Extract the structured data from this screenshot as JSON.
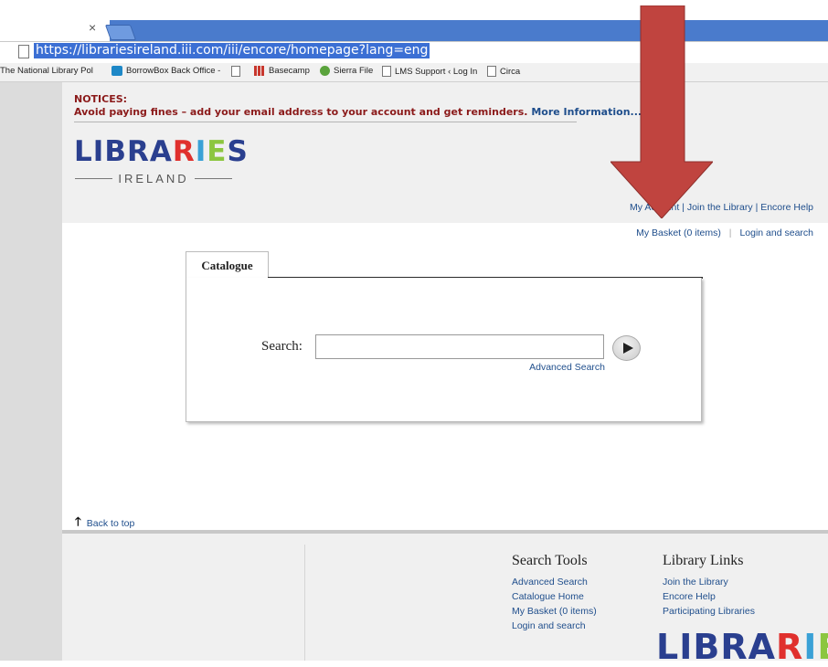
{
  "browser": {
    "tab_close": "×",
    "url": "https://librariesireland.iii.com/iii/encore/homepage?lang=eng",
    "bookmarks": [
      {
        "label": "The National Library Pol",
        "icon": "none"
      },
      {
        "label": "BorrowBox Back Office -",
        "icon": "borrowbox-icon"
      },
      {
        "label": "",
        "icon": "page-icon"
      },
      {
        "label": "Basecamp",
        "icon": "basecamp-icon"
      },
      {
        "label": "Sierra File",
        "icon": "sierra-icon"
      },
      {
        "label": "LMS Support ‹ Log In",
        "icon": "page-icon"
      },
      {
        "label": "Circa",
        "icon": "page-icon"
      }
    ]
  },
  "notice": {
    "title": "NOTICES:",
    "text": "Avoid paying fines – add your email address to your account and get reminders.",
    "link": "More Information..."
  },
  "logo": {
    "letters": [
      "L",
      "I",
      "B",
      "R",
      "A",
      "R",
      "I",
      "E",
      "S"
    ],
    "colors": [
      "#2a3f8f",
      "#2a3f8f",
      "#2a3f8f",
      "#2a3f8f",
      "#2a3f8f",
      "#e0302d",
      "#3aa1d6",
      "#8cc63f",
      "#2a3f8f"
    ],
    "sub": "IRELAND"
  },
  "top_links": {
    "my_account": "My Account",
    "join": "Join the Library",
    "help": "Encore Help",
    "sep": "|"
  },
  "basket_links": {
    "basket": "My Basket (0 items)",
    "login": "Login and search",
    "sep": "|"
  },
  "search": {
    "tab": "Catalogue",
    "label": "Search:",
    "input_value": "",
    "advanced": "Advanced Search"
  },
  "back_to_top": "Back to top",
  "footer": {
    "tools_title": "Search Tools",
    "tools": [
      "Advanced Search",
      "Catalogue Home",
      "My Basket (0 items)",
      "Login and search"
    ],
    "links_title": "Library Links",
    "links": [
      "Join the Library",
      "Encore Help",
      "Participating Libraries"
    ],
    "logo_text": "LIBRARIE"
  },
  "colors": {
    "notice": "#8b1a1a",
    "link": "#1f4e8c",
    "annotation_arrow": "#c0443f"
  }
}
